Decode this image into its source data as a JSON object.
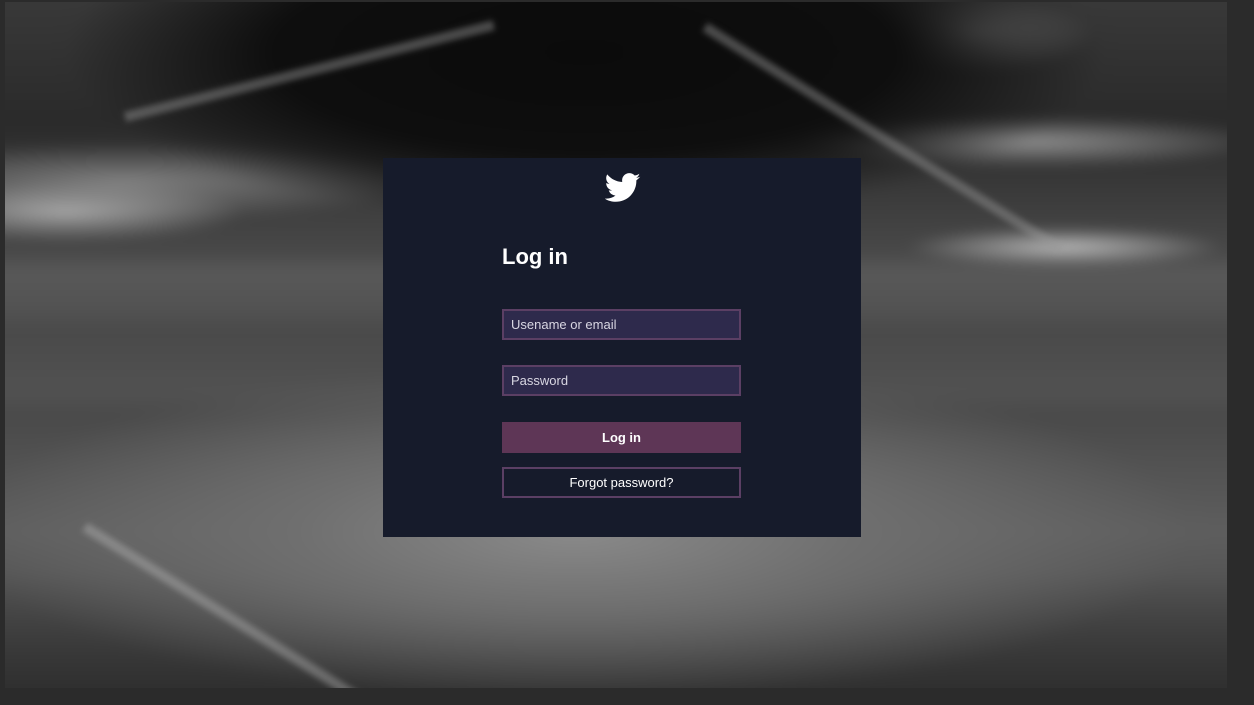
{
  "login_card": {
    "logo_icon": "twitter-bird-icon",
    "title": "Log in",
    "username": {
      "placeholder": "Usename or email",
      "value": ""
    },
    "password": {
      "placeholder": "Password",
      "value": ""
    },
    "login_button_label": "Log in",
    "forgot_button_label": "Forgot password?"
  },
  "colors": {
    "page_bg": "#2b2b2b",
    "card_bg": "#161b2b",
    "input_bg": "#2e2a4c",
    "input_border": "#5b3f64",
    "primary_button": "#5e3656",
    "text": "#ffffff"
  }
}
